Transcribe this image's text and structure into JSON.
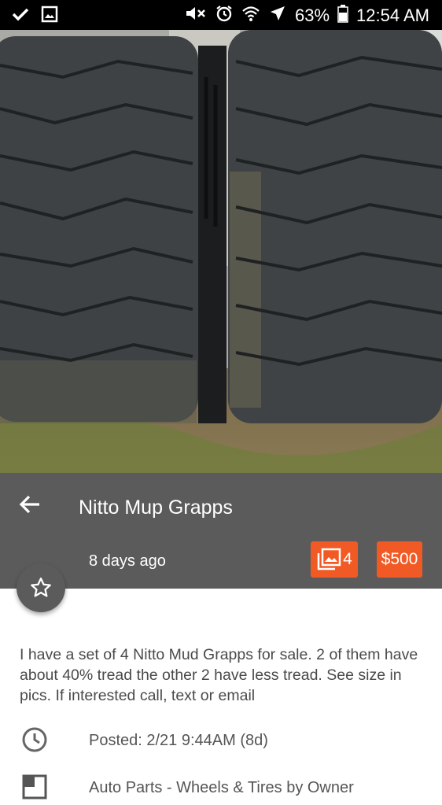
{
  "status_bar": {
    "battery_percent": "63%",
    "time": "12:54 AM",
    "icons": [
      "check-icon",
      "image-icon",
      "mute-icon",
      "alarm-icon",
      "wifi-icon",
      "airplane-mode-icon",
      "battery-icon"
    ]
  },
  "listing": {
    "title": "Nitto Mup Grapps",
    "posted_ago": "8 days ago",
    "photo_count": "4",
    "price": "$500",
    "description": "I have a set of 4 Nitto Mud Grapps for sale. 2 of them have about 40% tread the other 2 have less tread. See size in pics. If interested call, text or email",
    "posted": "Posted: 2/21 9:44AM (8d)",
    "category": "Auto Parts - Wheels & Tires by Owner"
  },
  "colors": {
    "header_bg": "#5b5b5b",
    "accent": "#f15a24",
    "status_bar_bg": "#000000"
  }
}
